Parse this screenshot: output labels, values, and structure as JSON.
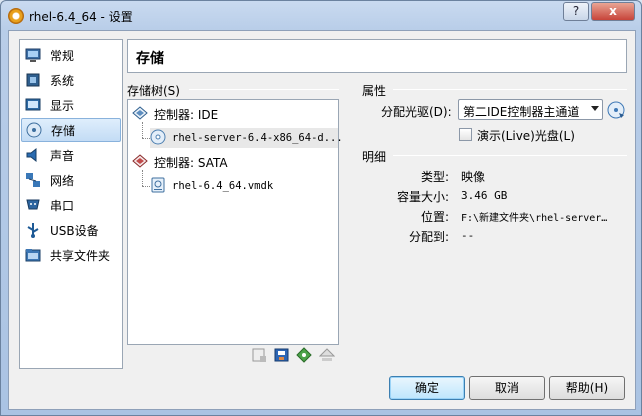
{
  "window": {
    "title": "rhel-6.4_64 - 设置",
    "help_label": "?",
    "close_label": "x"
  },
  "sidebar": {
    "items": [
      {
        "label": "常规",
        "icon": "general-icon"
      },
      {
        "label": "系统",
        "icon": "system-icon"
      },
      {
        "label": "显示",
        "icon": "display-icon"
      },
      {
        "label": "存储",
        "icon": "storage-icon",
        "active": true
      },
      {
        "label": "声音",
        "icon": "audio-icon"
      },
      {
        "label": "网络",
        "icon": "network-icon"
      },
      {
        "label": "串口",
        "icon": "serial-port-icon"
      },
      {
        "label": "USB设备",
        "icon": "usb-icon"
      },
      {
        "label": "共享文件夹",
        "icon": "shared-folder-icon"
      }
    ]
  },
  "page": {
    "title": "存储"
  },
  "storage_tree": {
    "label": "存储树(S)",
    "controllers": [
      {
        "name": "控制器: IDE",
        "devices": [
          {
            "name": "rhel-server-6.4-x86_64-d...",
            "type": "optical"
          }
        ]
      },
      {
        "name": "控制器: SATA",
        "devices": [
          {
            "name": "rhel-6.4_64.vmdk",
            "type": "disk"
          }
        ]
      }
    ]
  },
  "attributes": {
    "section_label": "属性",
    "drive_label": "分配光驱(D):",
    "drive_value": "第二IDE控制器主通道",
    "live_cd_label": "演示(Live)光盘(L)"
  },
  "details": {
    "section_label": "明细",
    "rows": [
      {
        "label": "类型:",
        "value": "映像"
      },
      {
        "label": "容量大小:",
        "value": "3.46  GB"
      },
      {
        "label": "位置:",
        "value": "F:\\新建文件夹\\rhel-server…"
      },
      {
        "label": "分配到:",
        "value": "--"
      }
    ]
  },
  "buttons": {
    "ok": "确定",
    "cancel": "取消",
    "help": "帮助(H)"
  },
  "colors": {
    "selection": "#c3dcf5",
    "accent": "#3c7fb1"
  }
}
